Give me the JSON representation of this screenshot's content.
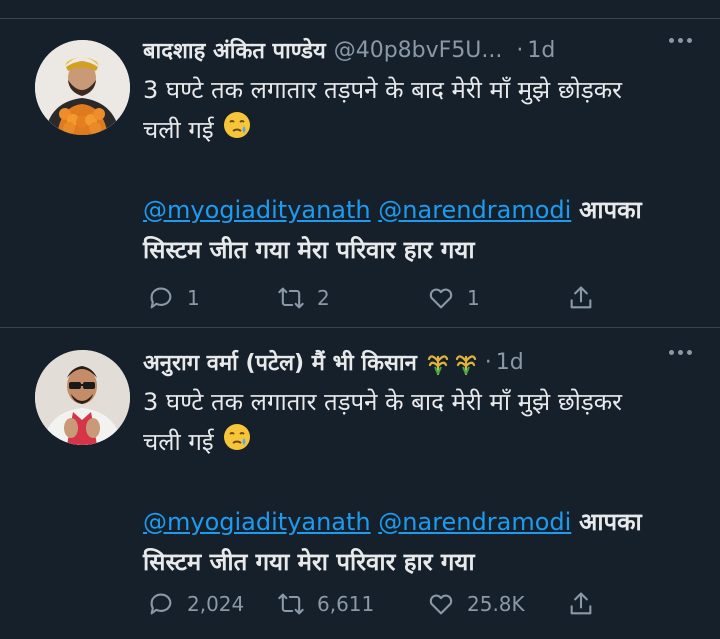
{
  "tweets": [
    {
      "display_name": "बादशाह अंकित पाण्डेय",
      "handle": "@40p8bvF5U...",
      "separator": "·",
      "time": "1d",
      "lines": [
        "3 घण्टे तक लगातार तड़पने के बाद मेरी माँ मुझे छोड़कर",
        "चली गई"
      ],
      "mentions": [
        "@myogiadityanath",
        "@narendramodi"
      ],
      "mention_tail": "आपका",
      "last_line": "सिस्टम जीत गया मेरा परिवार हार गया",
      "stats": {
        "replies": "1",
        "retweets": "2",
        "likes": "1"
      }
    },
    {
      "display_name": "अनुराग वर्मा (पटेल) मैं भी किसान",
      "separator": "·",
      "time": "1d",
      "lines": [
        "3 घण्टे तक लगातार तड़पने के बाद मेरी माँ मुझे छोड़कर",
        "चली गई"
      ],
      "mentions": [
        "@myogiadityanath",
        "@narendramodi"
      ],
      "mention_tail": "आपका",
      "last_line": "सिस्टम जीत गया मेरा परिवार हार गया",
      "stats": {
        "replies": "2,024",
        "retweets": "6,611",
        "likes": "25.8K"
      }
    }
  ],
  "icons": {
    "reply": "reply-icon",
    "retweet": "retweet-icon",
    "like": "heart-icon",
    "share": "share-icon",
    "more": "more-icon",
    "crying_emoji": "sad-face-emoji",
    "sheaf_emoji": "sheaf-of-rice-emoji"
  },
  "colors": {
    "background": "#15202b",
    "text": "#e7e9ea",
    "secondary": "#8b98a5",
    "link": "#1d9bf0",
    "divider": "#38444d"
  }
}
